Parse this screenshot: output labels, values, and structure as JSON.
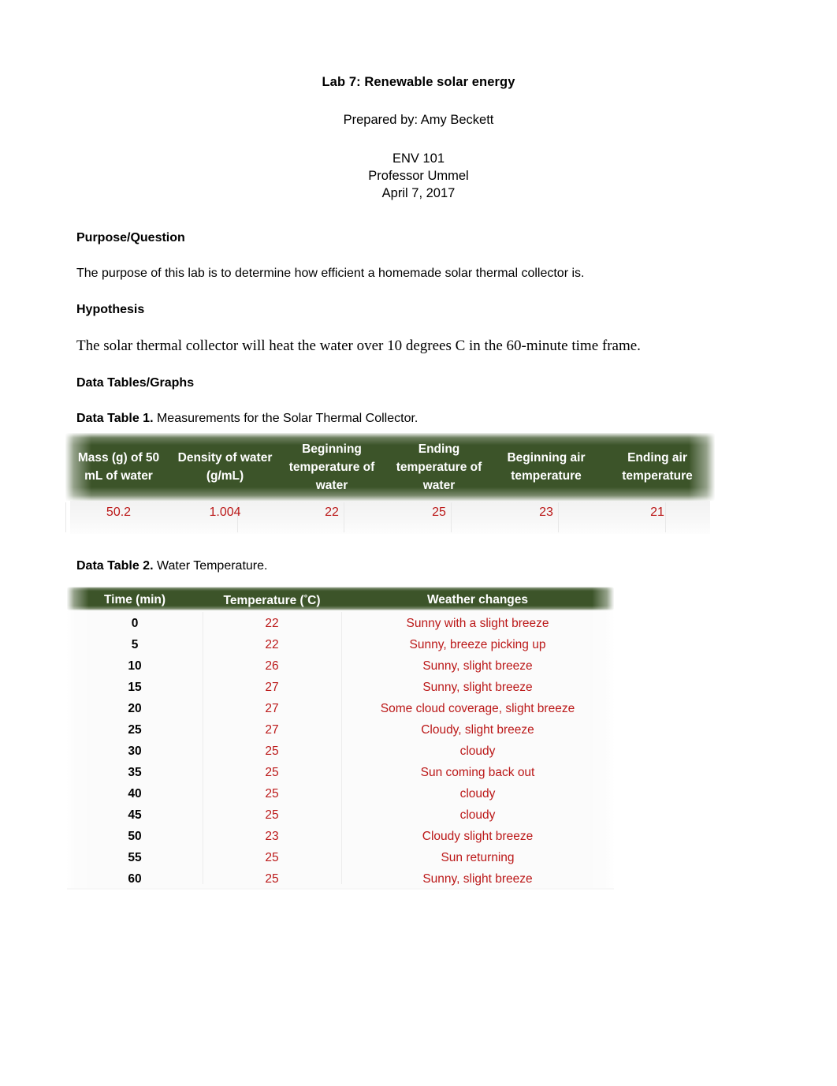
{
  "document": {
    "title": "Lab 7: Renewable solar energy",
    "prepared_by": "Prepared by: Amy Beckett",
    "course": "ENV 101",
    "professor": "Professor Ummel",
    "date": "April 7, 2017"
  },
  "sections": {
    "purpose_heading": "Purpose/Question",
    "purpose_text": "The purpose of this lab is to determine how efficient a homemade solar thermal collector is.",
    "hypothesis_heading": "Hypothesis",
    "hypothesis_text": "The solar thermal collector will heat the water over 10 degrees C in the 60-minute time frame.",
    "data_heading": "Data Tables/Graphs"
  },
  "table1": {
    "caption_label": "Data Table 1.",
    "caption_text": "Measurements for the Solar Thermal Collector.",
    "headers": [
      "Mass (g) of 50 mL of water",
      "Density of water (g/mL)",
      "Beginning temperature of water",
      "Ending temperature of water",
      "Beginning air temperature",
      "Ending air temperature"
    ],
    "values": [
      "50.2",
      "1.004",
      "22",
      "25",
      "23",
      "21"
    ]
  },
  "table2": {
    "caption_label": "Data Table 2.",
    "caption_text": "Water Temperature.",
    "headers": [
      "Time (min)",
      "Temperature (°C)",
      "Weather changes"
    ],
    "header_temperature_prefix": "Temperature (",
    "header_temperature_suffix": "C)",
    "rows": [
      {
        "time": "0",
        "temp": "22",
        "weather": "Sunny with a slight breeze"
      },
      {
        "time": "5",
        "temp": "22",
        "weather": "Sunny, breeze picking up"
      },
      {
        "time": "10",
        "temp": "26",
        "weather": "Sunny, slight breeze"
      },
      {
        "time": "15",
        "temp": "27",
        "weather": "Sunny, slight breeze"
      },
      {
        "time": "20",
        "temp": "27",
        "weather": "Some cloud coverage, slight breeze"
      },
      {
        "time": "25",
        "temp": "27",
        "weather": "Cloudy, slight breeze"
      },
      {
        "time": "30",
        "temp": "25",
        "weather": "cloudy"
      },
      {
        "time": "35",
        "temp": "25",
        "weather": "Sun coming back out"
      },
      {
        "time": "40",
        "temp": "25",
        "weather": "cloudy"
      },
      {
        "time": "45",
        "temp": "25",
        "weather": "cloudy"
      },
      {
        "time": "50",
        "temp": "23",
        "weather": "Cloudy slight breeze"
      },
      {
        "time": "55",
        "temp": "25",
        "weather": "Sun returning"
      },
      {
        "time": "60",
        "temp": "25",
        "weather": "Sunny, slight breeze"
      }
    ]
  },
  "colors": {
    "header_green": "#3c5429",
    "data_red": "#bb1818",
    "text_black": "#000000",
    "page_background": "#ffffff"
  }
}
